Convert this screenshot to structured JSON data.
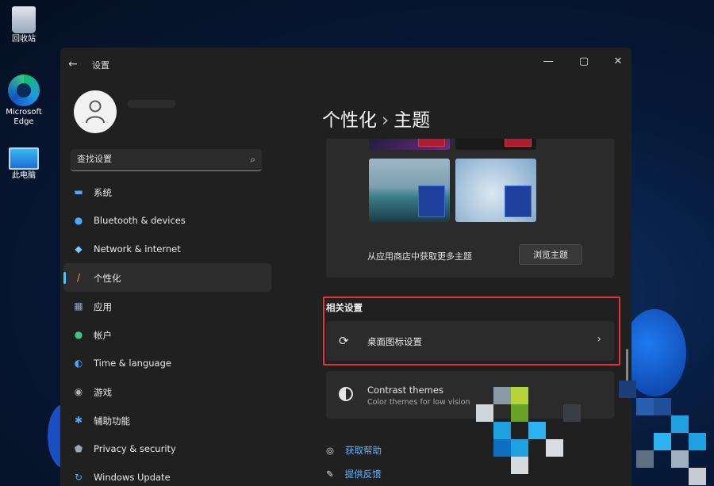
{
  "desktop": {
    "icons": [
      {
        "label": "回收站",
        "icon": "recycle-bin-icon"
      },
      {
        "label": "Microsoft Edge",
        "icon": "edge-browser-icon"
      },
      {
        "label": "此电脑",
        "icon": "this-pc-icon"
      }
    ]
  },
  "window": {
    "title": "设置",
    "controls": {
      "minimize": "—",
      "maximize": "▢",
      "close": "✕"
    }
  },
  "search": {
    "placeholder": "查找设置"
  },
  "sidebar": {
    "items": [
      {
        "label": "系统",
        "icon": "monitor-icon",
        "color": "#4aa8ff"
      },
      {
        "label": "Bluetooth & devices",
        "icon": "bluetooth-icon",
        "color": "#4aa8ff"
      },
      {
        "label": "Network & internet",
        "icon": "wifi-icon",
        "color": "#7bc6ff"
      },
      {
        "label": "个性化",
        "icon": "brush-icon",
        "color": "#f0a35a",
        "active": true
      },
      {
        "label": "应用",
        "icon": "apps-icon",
        "color": "#8fa3c0"
      },
      {
        "label": "帐户",
        "icon": "person-icon",
        "color": "#3fc38d"
      },
      {
        "label": "Time & language",
        "icon": "globe-clock-icon",
        "color": "#4aa8ff"
      },
      {
        "label": "游戏",
        "icon": "gamepad-icon",
        "color": "#b0b0b0"
      },
      {
        "label": "辅助功能",
        "icon": "accessibility-icon",
        "color": "#4aa8ff"
      },
      {
        "label": "Privacy & security",
        "icon": "shield-icon",
        "color": "#9aa5b5"
      },
      {
        "label": "Windows Update",
        "icon": "update-icon",
        "color": "#4aa8ff"
      }
    ]
  },
  "main": {
    "breadcrumb": {
      "parent": "个性化",
      "separator": "›",
      "current": "主题"
    },
    "store_text": "从应用商店中获取更多主题",
    "browse_button": "浏览主题",
    "related_title": "相关设置",
    "related_row": {
      "label": "桌面图标设置",
      "icon": "desktop-settings-icon"
    },
    "contrast": {
      "title": "Contrast themes",
      "subtitle": "Color themes for low vision"
    },
    "help_links": [
      {
        "label": "获取帮助",
        "icon": "help-icon"
      },
      {
        "label": "提供反馈",
        "icon": "feedback-icon"
      }
    ]
  },
  "colors": {
    "accent": "#4cc2ff",
    "highlight": "#e2343a",
    "link": "#5fb6ff"
  }
}
